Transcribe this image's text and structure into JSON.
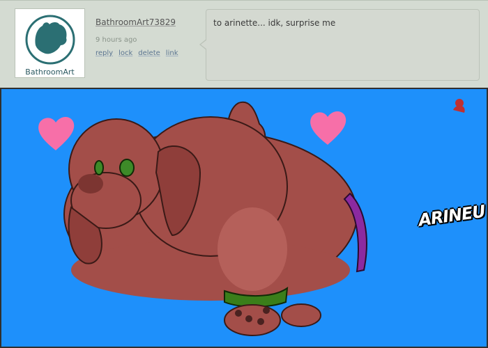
{
  "comment": {
    "author": "BathroomArt73829",
    "avatar_label": "BathroomArt",
    "time_ago": "9 hours ago",
    "actions": {
      "reply": "reply",
      "lock": "lock",
      "delete": "delete",
      "link": "link"
    },
    "body": "to arinette... idk, surprise me"
  },
  "artwork": {
    "signature": "ARINEU",
    "background_color": "#1e90fb",
    "heart_color": "#f76fa8"
  }
}
